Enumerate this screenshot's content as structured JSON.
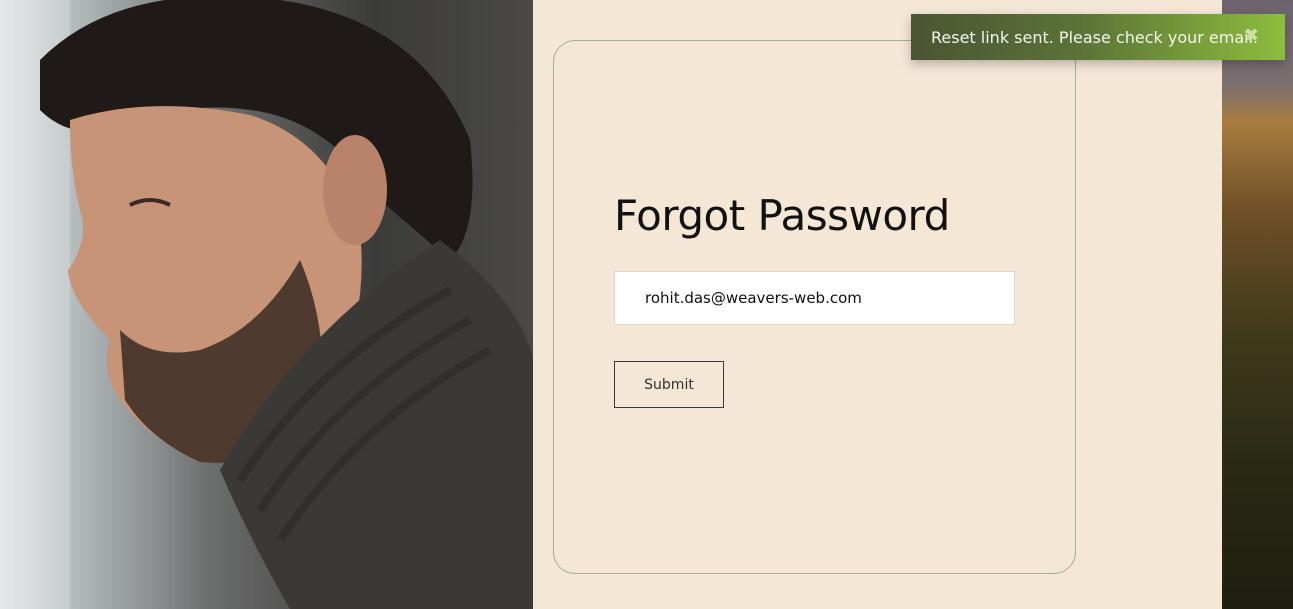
{
  "toast": {
    "message": "Reset link sent. Please check your email.",
    "close_glyph": "✖",
    "close_icon": "close-icon",
    "color_start": "#4a5534",
    "color_end": "#8dbd3d"
  },
  "form": {
    "title": "Forgot Password",
    "email_value": "rohit.das@weavers-web.com",
    "submit_label": "Submit"
  },
  "colors": {
    "background": "#f4e7d6",
    "card_border": "#9fb18f"
  }
}
